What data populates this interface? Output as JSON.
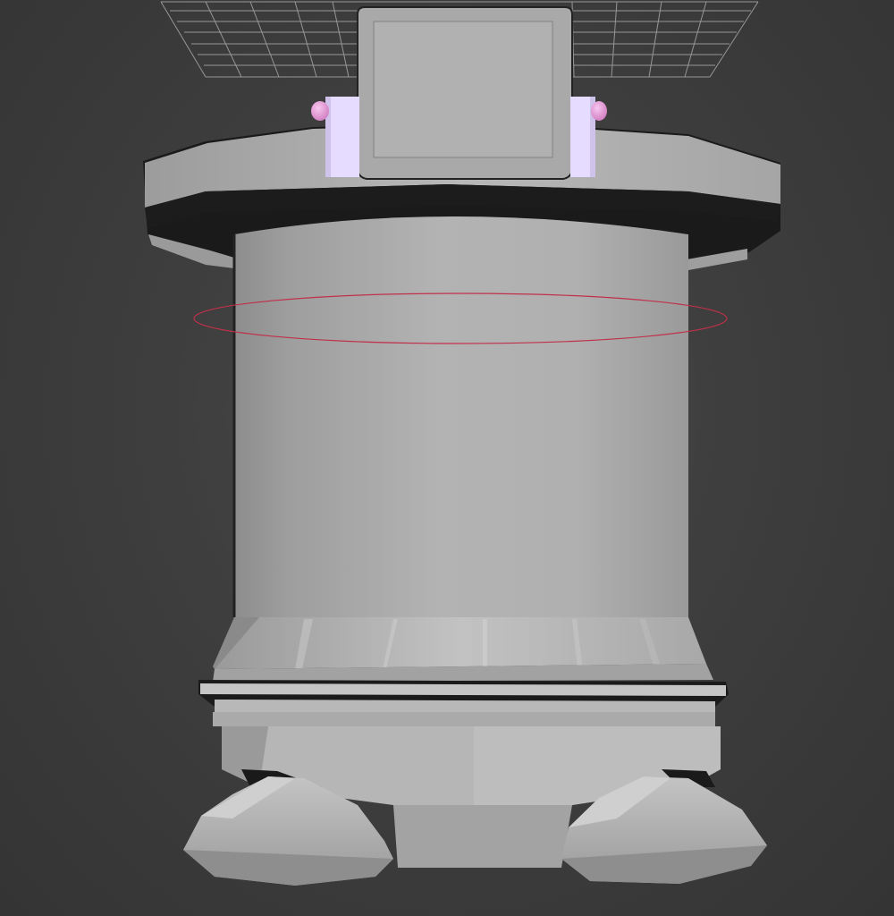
{
  "viewport": {
    "background_color": "#3d3d3d",
    "grid_color": "#a8a8a8"
  },
  "model": {
    "body_color": "#b0b0b0",
    "shadow_color": "#8a8a8a",
    "highlight_color": "#c8c8c8",
    "accent_color": "#e6dcff",
    "knob_color": "#e89bd8",
    "selection_ring_color": "#c0304a"
  }
}
